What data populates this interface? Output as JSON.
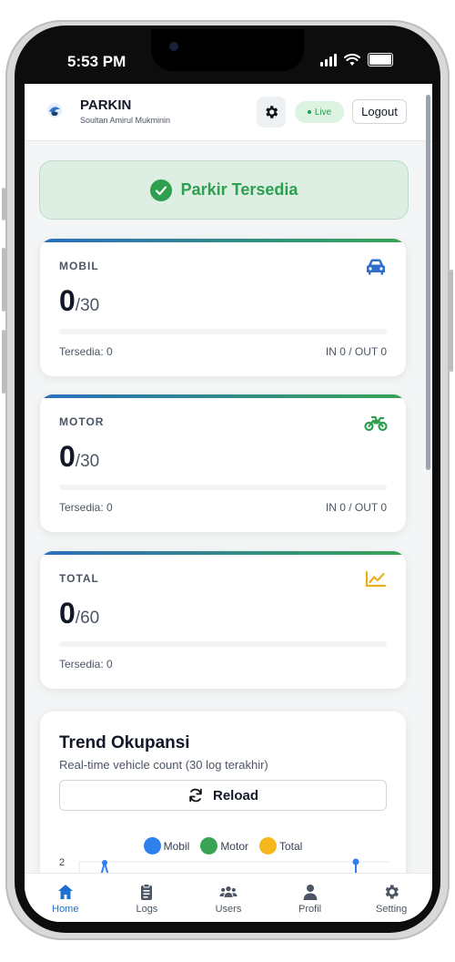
{
  "status_bar": {
    "time": "5:53 PM"
  },
  "header": {
    "title": "PARKIN",
    "subtitle": "Soultan Amirul Mukminin",
    "live_label": "Live",
    "logout_label": "Logout"
  },
  "banner": {
    "text": "Parkir Tersedia"
  },
  "cards": [
    {
      "label": "MOBIL",
      "value": "0",
      "capacity": "/30",
      "available": "Tersedia: 0",
      "inout": "IN 0 / OUT 0",
      "icon": "car-icon",
      "icon_color": "#2f6fc7",
      "occupancy_fraction": 0
    },
    {
      "label": "MOTOR",
      "value": "0",
      "capacity": "/30",
      "available": "Tersedia: 0",
      "inout": "IN 0 / OUT 0",
      "icon": "motorcycle-icon",
      "icon_color": "#2e9e4f",
      "occupancy_fraction": 0
    },
    {
      "label": "TOTAL",
      "value": "0",
      "capacity": "/60",
      "available": "Tersedia: 0",
      "icon": "chart-line-icon",
      "icon_color": "#e8b11c",
      "occupancy_fraction": 0
    }
  ],
  "trend": {
    "title": "Trend Okupansi",
    "subtitle": "Real-time vehicle count (30 log terakhir)",
    "reload_label": "Reload",
    "legend": [
      {
        "name": "Mobil",
        "color": "#2f80ed"
      },
      {
        "name": "Motor",
        "color": "#3aa455"
      },
      {
        "name": "Total",
        "color": "#f5b81c"
      }
    ],
    "y_tick_top": "2"
  },
  "nav": [
    {
      "label": "Home",
      "icon": "home-icon",
      "active": true
    },
    {
      "label": "Logs",
      "icon": "clipboard-icon",
      "active": false
    },
    {
      "label": "Users",
      "icon": "users-icon",
      "active": false
    },
    {
      "label": "Profil",
      "icon": "person-icon",
      "active": false
    },
    {
      "label": "Setting",
      "icon": "gear-icon",
      "active": false
    }
  ],
  "colors": {
    "accent": "#1d6fd1",
    "success": "#2e9e4f",
    "banner_bg": "#dcefe2"
  }
}
